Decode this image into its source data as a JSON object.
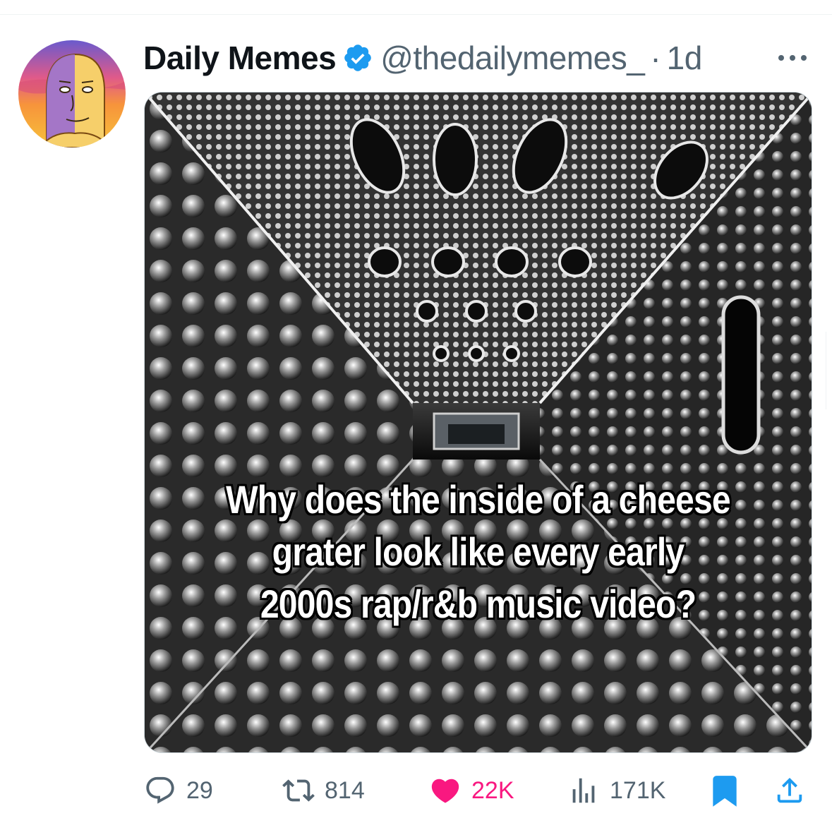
{
  "post": {
    "display_name": "Daily Memes",
    "handle": "@thedailymemes_",
    "separator": "·",
    "time": "1d",
    "verified": true,
    "verified_color": "#1d9bf0",
    "media": {
      "caption_lines": [
        "Why does the inside of a cheese",
        "grater look like every early",
        "2000s rap/r&b music video?"
      ]
    },
    "actions": {
      "replies": "29",
      "reposts": "814",
      "likes": "22K",
      "views": "171K"
    },
    "liked": true,
    "like_color": "#f91880",
    "bookmarked": true,
    "bookmark_color": "#1d9bf0",
    "icons": [
      "more-icon",
      "reply-icon",
      "repost-icon",
      "like-icon",
      "views-icon",
      "bookmark-icon",
      "share-icon",
      "verified-badge-icon"
    ]
  }
}
